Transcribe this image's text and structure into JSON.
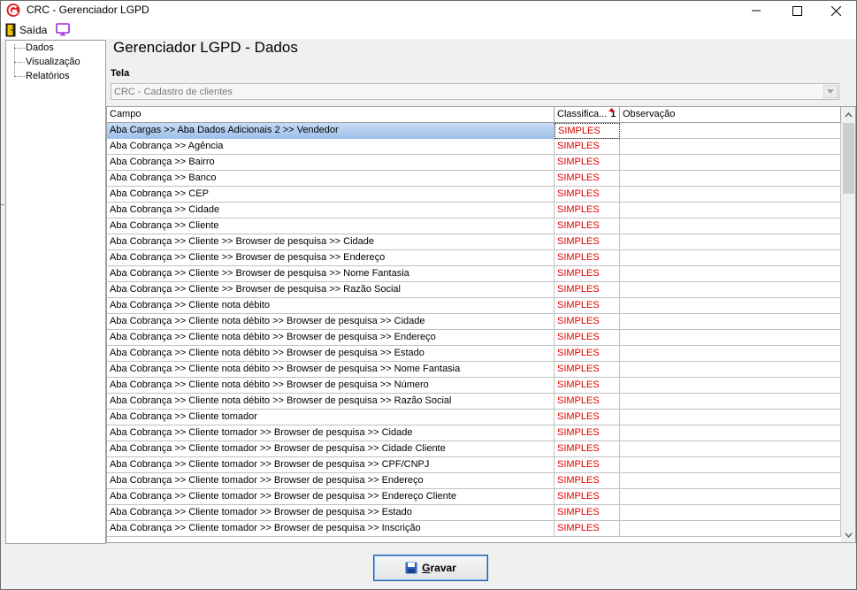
{
  "window": {
    "title": "CRC - Gerenciador LGPD"
  },
  "toolbar": {
    "exit_label": "Saída"
  },
  "sidebar": {
    "items": [
      {
        "label": "Dados"
      },
      {
        "label": "Visualização"
      },
      {
        "label": "Relatórios"
      }
    ]
  },
  "main": {
    "page_title": "Gerenciador LGPD - Dados",
    "screen_label": "Tela",
    "screen_value": "CRC - Cadastro de clientes"
  },
  "grid": {
    "columns": {
      "campo": "Campo",
      "classificacao": "Classifica...",
      "sort_index": "1",
      "observacao": "Observação"
    },
    "rows": [
      {
        "campo": "Aba Cargas >> Aba Dados Adicionais 2 >> Vendedor",
        "classificacao": "SIMPLES",
        "observacao": ""
      },
      {
        "campo": "Aba Cobrança >> Agência",
        "classificacao": "SIMPLES",
        "observacao": ""
      },
      {
        "campo": "Aba Cobrança >> Bairro",
        "classificacao": "SIMPLES",
        "observacao": ""
      },
      {
        "campo": "Aba Cobrança >> Banco",
        "classificacao": "SIMPLES",
        "observacao": ""
      },
      {
        "campo": "Aba Cobrança >> CEP",
        "classificacao": "SIMPLES",
        "observacao": ""
      },
      {
        "campo": "Aba Cobrança >> Cidade",
        "classificacao": "SIMPLES",
        "observacao": ""
      },
      {
        "campo": "Aba Cobrança >> Cliente",
        "classificacao": "SIMPLES",
        "observacao": ""
      },
      {
        "campo": "Aba Cobrança >> Cliente >> Browser de pesquisa >> Cidade",
        "classificacao": "SIMPLES",
        "observacao": ""
      },
      {
        "campo": "Aba Cobrança >> Cliente >> Browser de pesquisa >> Endereço",
        "classificacao": "SIMPLES",
        "observacao": ""
      },
      {
        "campo": "Aba Cobrança >> Cliente >> Browser de pesquisa >> Nome Fantasia",
        "classificacao": "SIMPLES",
        "observacao": ""
      },
      {
        "campo": "Aba Cobrança >> Cliente >> Browser de pesquisa >> Razão Social",
        "classificacao": "SIMPLES",
        "observacao": ""
      },
      {
        "campo": "Aba Cobrança >> Cliente nota débito",
        "classificacao": "SIMPLES",
        "observacao": ""
      },
      {
        "campo": "Aba Cobrança >> Cliente nota débito >> Browser de pesquisa >> Cidade",
        "classificacao": "SIMPLES",
        "observacao": ""
      },
      {
        "campo": "Aba Cobrança >> Cliente nota débito >> Browser de pesquisa >> Endereço",
        "classificacao": "SIMPLES",
        "observacao": ""
      },
      {
        "campo": "Aba Cobrança >> Cliente nota débito >> Browser de pesquisa >> Estado",
        "classificacao": "SIMPLES",
        "observacao": ""
      },
      {
        "campo": "Aba Cobrança >> Cliente nota débito >> Browser de pesquisa >> Nome Fantasia",
        "classificacao": "SIMPLES",
        "observacao": ""
      },
      {
        "campo": "Aba Cobrança >> Cliente nota débito >> Browser de pesquisa >> Número",
        "classificacao": "SIMPLES",
        "observacao": ""
      },
      {
        "campo": "Aba Cobrança >> Cliente nota débito >> Browser de pesquisa >> Razão Social",
        "classificacao": "SIMPLES",
        "observacao": ""
      },
      {
        "campo": "Aba Cobrança >> Cliente tomador",
        "classificacao": "SIMPLES",
        "observacao": ""
      },
      {
        "campo": "Aba Cobrança >> Cliente tomador >> Browser de pesquisa >> Cidade",
        "classificacao": "SIMPLES",
        "observacao": ""
      },
      {
        "campo": "Aba Cobrança >> Cliente tomador >> Browser de pesquisa >> Cidade Cliente",
        "classificacao": "SIMPLES",
        "observacao": ""
      },
      {
        "campo": "Aba Cobrança >> Cliente tomador >> Browser de pesquisa >> CPF/CNPJ",
        "classificacao": "SIMPLES",
        "observacao": ""
      },
      {
        "campo": "Aba Cobrança >> Cliente tomador >> Browser de pesquisa >> Endereço",
        "classificacao": "SIMPLES",
        "observacao": ""
      },
      {
        "campo": "Aba Cobrança >> Cliente tomador >> Browser de pesquisa >> Endereço Cliente",
        "classificacao": "SIMPLES",
        "observacao": ""
      },
      {
        "campo": "Aba Cobrança >> Cliente tomador >> Browser de pesquisa >> Estado",
        "classificacao": "SIMPLES",
        "observacao": ""
      },
      {
        "campo": "Aba Cobrança >> Cliente tomador >> Browser de pesquisa >> Inscrição",
        "classificacao": "SIMPLES",
        "observacao": ""
      }
    ]
  },
  "footer": {
    "save_label_rest": "ravar",
    "save_label_accel": "G"
  },
  "colors": {
    "classification_text": "#e00000",
    "selected_row": "#9ebfe8",
    "accent": "#1c5da8"
  },
  "icons": {
    "app": "crc-logo-icon",
    "exit": "exit-door-icon",
    "screen": "monitor-icon",
    "save": "floppy-disk-icon",
    "sort": "sort-ascending-icon"
  }
}
